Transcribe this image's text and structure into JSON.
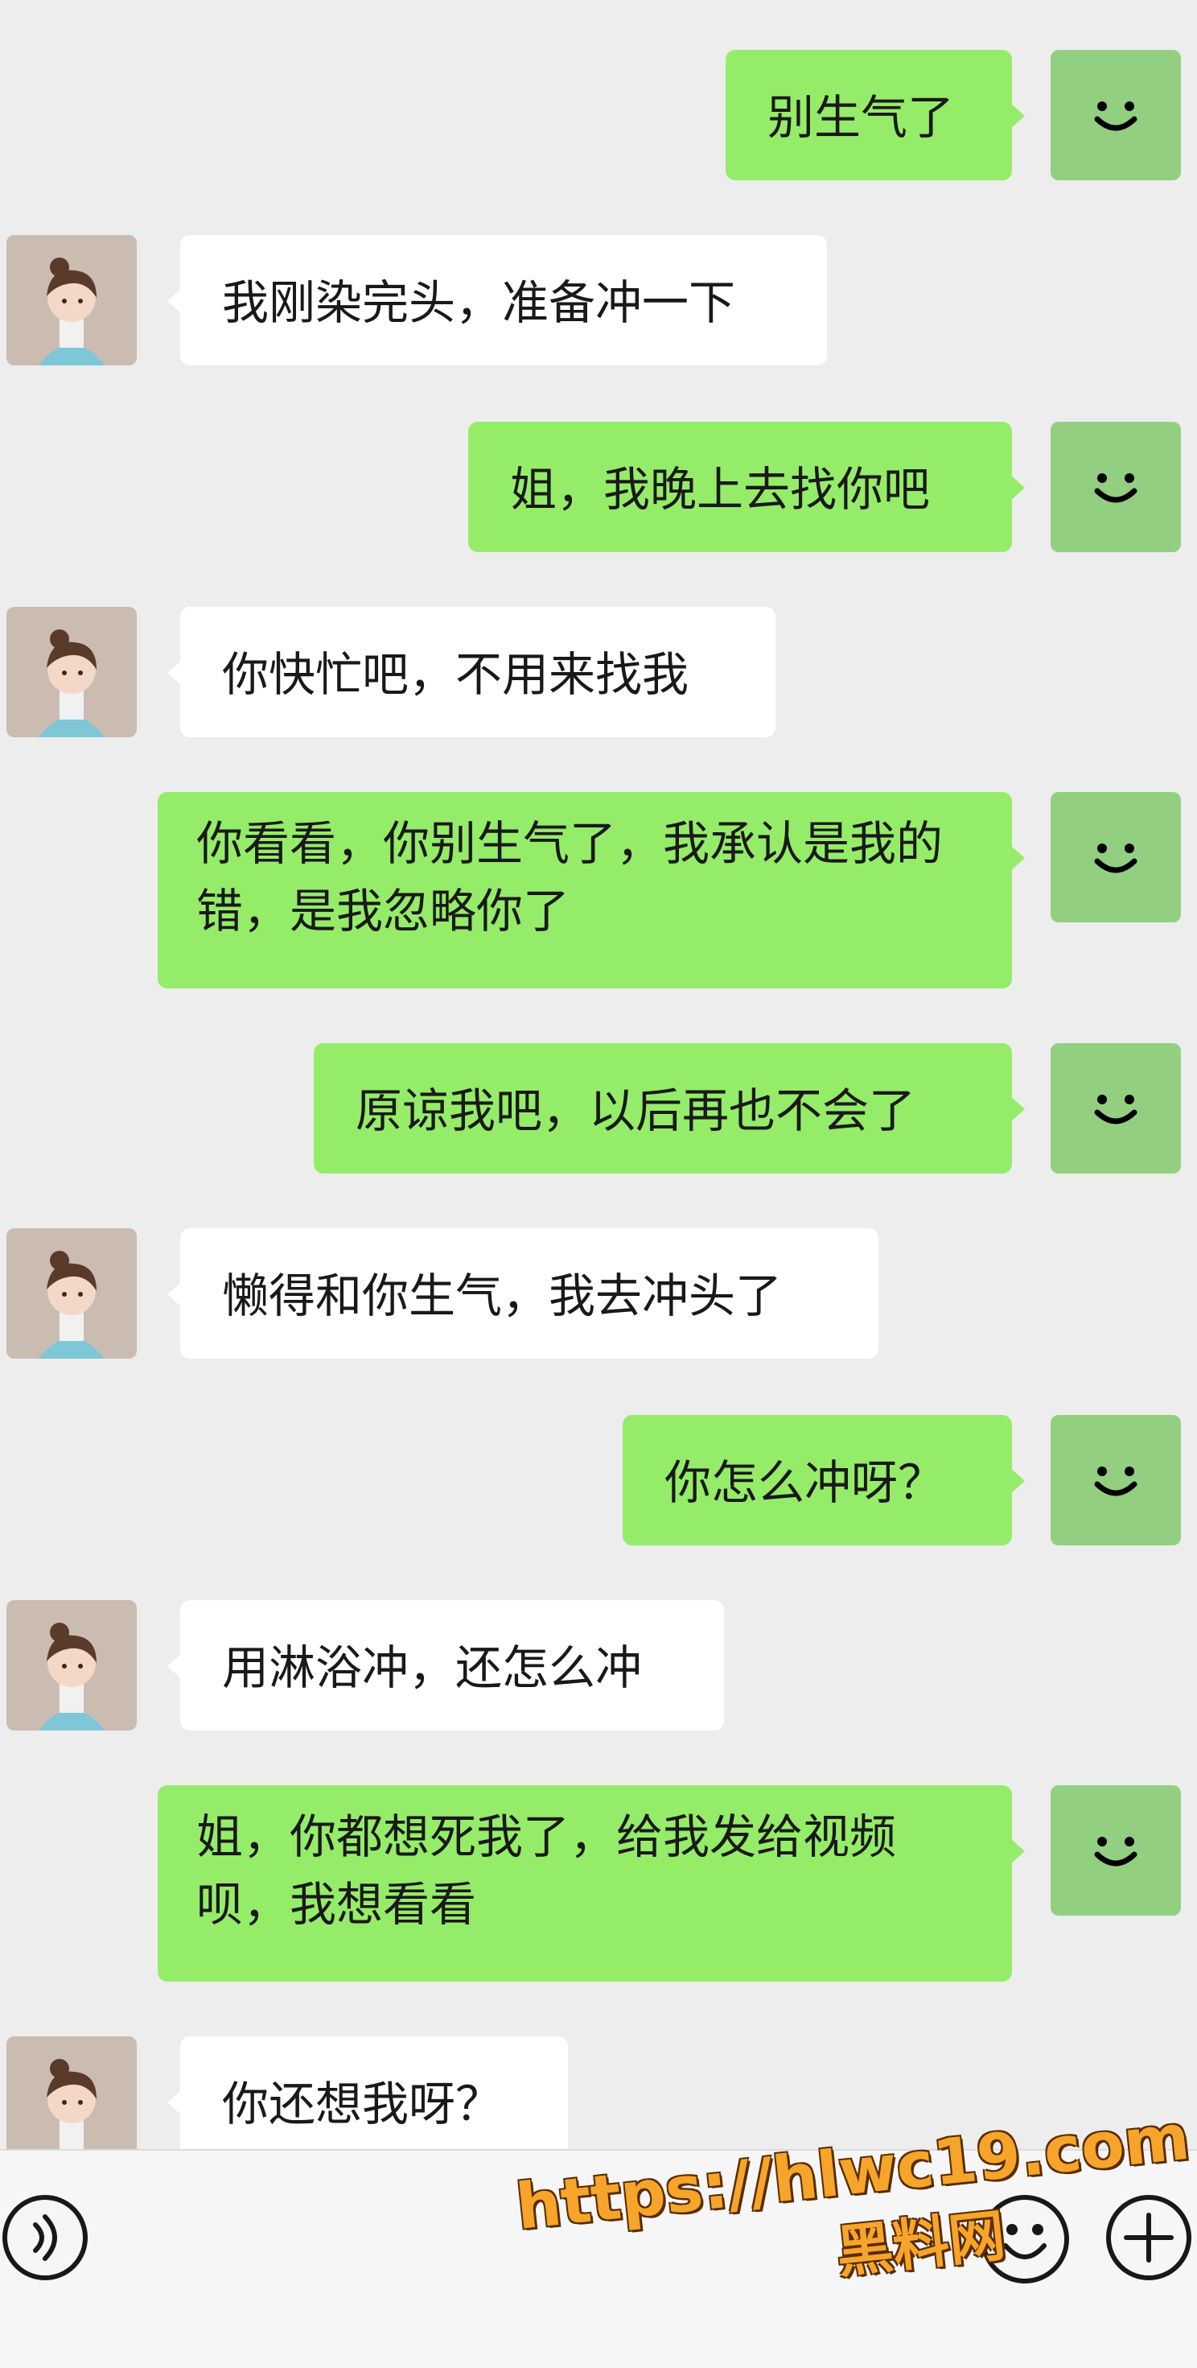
{
  "messages": [
    {
      "side": "self",
      "text": "别生气了"
    },
    {
      "side": "other",
      "text": "我刚染完头，准备冲一下"
    },
    {
      "side": "self",
      "text": "姐，我晚上去找你吧"
    },
    {
      "side": "other",
      "text": "你快忙吧，不用来找我"
    },
    {
      "side": "self",
      "text": "你看看，你别生气了，我承认是我的错，是我忽略你了"
    },
    {
      "side": "self",
      "text": "原谅我吧，以后再也不会了"
    },
    {
      "side": "other",
      "text": "懒得和你生气，我去冲头了"
    },
    {
      "side": "self",
      "text": "你怎么冲呀？"
    },
    {
      "side": "other",
      "text": "用淋浴冲，还怎么冲"
    },
    {
      "side": "self",
      "text": "姐，你都想死我了，给我发给视频呗，我想看看"
    },
    {
      "side": "other",
      "text": "你还想我呀？"
    }
  ],
  "input_bar": {
    "voice_icon": "voice-icon",
    "emoji_icon": "emoji-icon",
    "plus_icon": "plus-icon"
  },
  "watermark": {
    "url": "https://hlwc19.com",
    "site": "黑料网"
  },
  "colors": {
    "background": "#ededed",
    "self_bubble": "#95ec69",
    "other_bubble": "#ffffff",
    "self_avatar": "#93cf80",
    "watermark": "#f6a52a"
  }
}
